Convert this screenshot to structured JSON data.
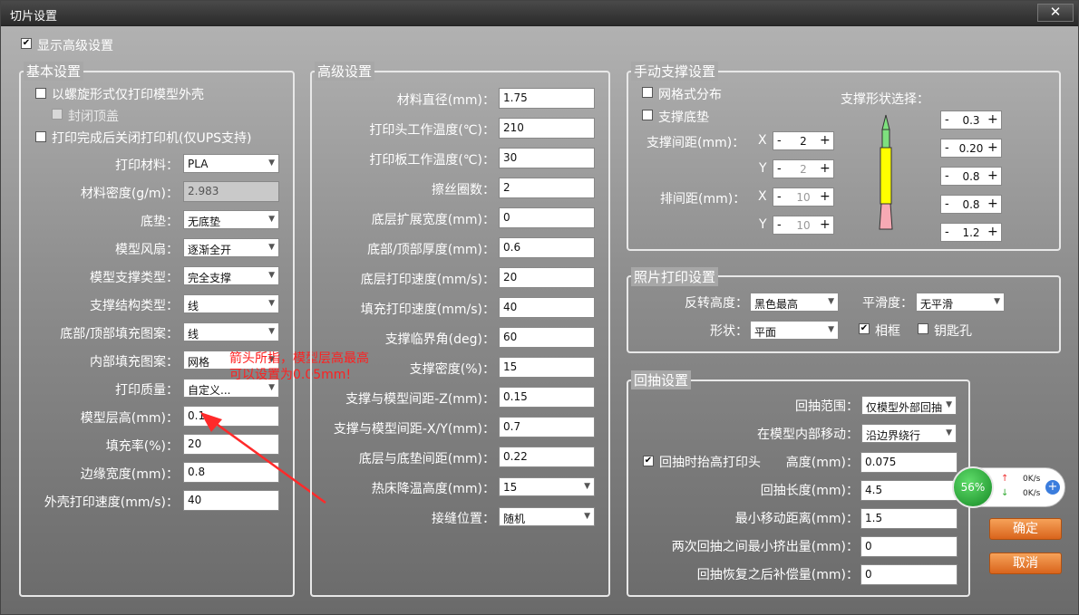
{
  "window": {
    "title": "切片设置",
    "close_glyph": "✕"
  },
  "show_advanced": {
    "label": "显示高级设置",
    "checked": true
  },
  "basic": {
    "title": "基本设置",
    "spiral": {
      "label": "以螺旋形式仅打印模型外壳",
      "checked": false
    },
    "close_top": {
      "label": "封闭顶盖",
      "checked": false
    },
    "shutdown": {
      "label": "打印完成后关闭打印机(仅UPS支持)",
      "checked": false
    },
    "fields": [
      {
        "label": "打印材料：",
        "value": "PLA",
        "kind": "select"
      },
      {
        "label": "材料密度(g/m)：",
        "value": "2.983",
        "kind": "input_disabled"
      },
      {
        "label": "底垫：",
        "value": "无底垫",
        "kind": "select"
      },
      {
        "label": "模型风扇：",
        "value": "逐渐全开",
        "kind": "select"
      },
      {
        "label": "模型支撑类型：",
        "value": "完全支撑",
        "kind": "select"
      },
      {
        "label": "支撑结构类型：",
        "value": "线",
        "kind": "select"
      },
      {
        "label": "底部/顶部填充图案：",
        "value": "线",
        "kind": "select"
      },
      {
        "label": "内部填充图案：",
        "value": "网格",
        "kind": "select"
      },
      {
        "label": "打印质量：",
        "value": "自定义...",
        "kind": "select"
      },
      {
        "label": "模型层高(mm)：",
        "value": "0.1",
        "kind": "input"
      },
      {
        "label": "填充率(%)：",
        "value": "20",
        "kind": "input"
      },
      {
        "label": "边缘宽度(mm)：",
        "value": "0.8",
        "kind": "input"
      },
      {
        "label": "外壳打印速度(mm/s)：",
        "value": "40",
        "kind": "input"
      }
    ],
    "annotation_line1": "箭头所指，模型层高最高",
    "annotation_line2": "可以设置为0.05mm!"
  },
  "advanced": {
    "title": "高级设置",
    "fields": [
      {
        "label": "材料直径(mm)：",
        "value": "1.75",
        "kind": "input"
      },
      {
        "label": "打印头工作温度(℃)：",
        "value": "210",
        "kind": "input"
      },
      {
        "label": "打印板工作温度(℃)：",
        "value": "30",
        "kind": "input"
      },
      {
        "label": "擦丝圈数：",
        "value": "2",
        "kind": "input"
      },
      {
        "label": "底层扩展宽度(mm)：",
        "value": "0",
        "kind": "input"
      },
      {
        "label": "底部/顶部厚度(mm)：",
        "value": "0.6",
        "kind": "input"
      },
      {
        "label": "底层打印速度(mm/s)：",
        "value": "20",
        "kind": "input"
      },
      {
        "label": "填充打印速度(mm/s)：",
        "value": "40",
        "kind": "input"
      },
      {
        "label": "支撑临界角(deg)：",
        "value": "60",
        "kind": "input"
      },
      {
        "label": "支撑密度(%)：",
        "value": "15",
        "kind": "input"
      },
      {
        "label": "支撑与模型间距-Z(mm)：",
        "value": "0.15",
        "kind": "input"
      },
      {
        "label": "支撑与模型间距-X/Y(mm)：",
        "value": "0.7",
        "kind": "input"
      },
      {
        "label": "底层与底垫间距(mm)：",
        "value": "0.22",
        "kind": "input"
      },
      {
        "label": "热床降温高度(mm)：",
        "value": "15",
        "kind": "select"
      },
      {
        "label": "接缝位置：",
        "value": "随机",
        "kind": "select"
      }
    ]
  },
  "manual_support": {
    "title": "手动支撑设置",
    "grid": {
      "label": "网格式分布",
      "checked": false
    },
    "base": {
      "label": "支撑底垫",
      "checked": false
    },
    "spacing_label": "支撑间距(mm)：",
    "row_spacing_label": "排间距(mm)：",
    "x": "X",
    "y": "Y",
    "spacing_x": "2",
    "spacing_y": "2",
    "row_x": "10",
    "row_y": "10",
    "shape_label": "支撑形状选择：",
    "shape_values": [
      "0.3",
      "0.20",
      "0.8",
      "0.8",
      "1.2"
    ],
    "shape_colors": [
      "#7ee07e",
      "#ffff00",
      "#f7a9b4"
    ],
    "minus": "-",
    "plus": "+"
  },
  "photo": {
    "title": "照片打印设置",
    "invert_label": "反转高度：",
    "invert_value": "黑色最高",
    "smooth_label": "平滑度：",
    "smooth_value": "无平滑",
    "shape_label": "形状：",
    "shape_value": "平面",
    "frame": {
      "label": "相框",
      "checked": true
    },
    "keyhole": {
      "label": "钥匙孔",
      "checked": false
    }
  },
  "retract": {
    "title": "回抽设置",
    "range_label": "回抽范围：",
    "range_value": "仅模型外部回抽",
    "move_label": "在模型内部移动：",
    "move_value": "沿边界绕行",
    "lift": {
      "label": "回抽时抬高打印头",
      "checked": true
    },
    "height_label": "高度(mm)：",
    "height_value": "0.075",
    "length_label": "回抽长度(mm)：",
    "length_value": "4.5",
    "min_move_label": "最小移动距离(mm)：",
    "min_move_value": "1.5",
    "min_extrude_label": "两次回抽之间最小挤出量(mm)：",
    "min_extrude_value": "0",
    "comp_label": "回抽恢复之后补偿量(mm)：",
    "comp_value": "0"
  },
  "buttons": {
    "ok": "确定",
    "cancel": "取消"
  },
  "net_widget": {
    "percent": "56%",
    "up": "0K/s",
    "down": "0K/s",
    "up_arrow": "↑",
    "down_arrow": "↓",
    "plus": "+"
  }
}
